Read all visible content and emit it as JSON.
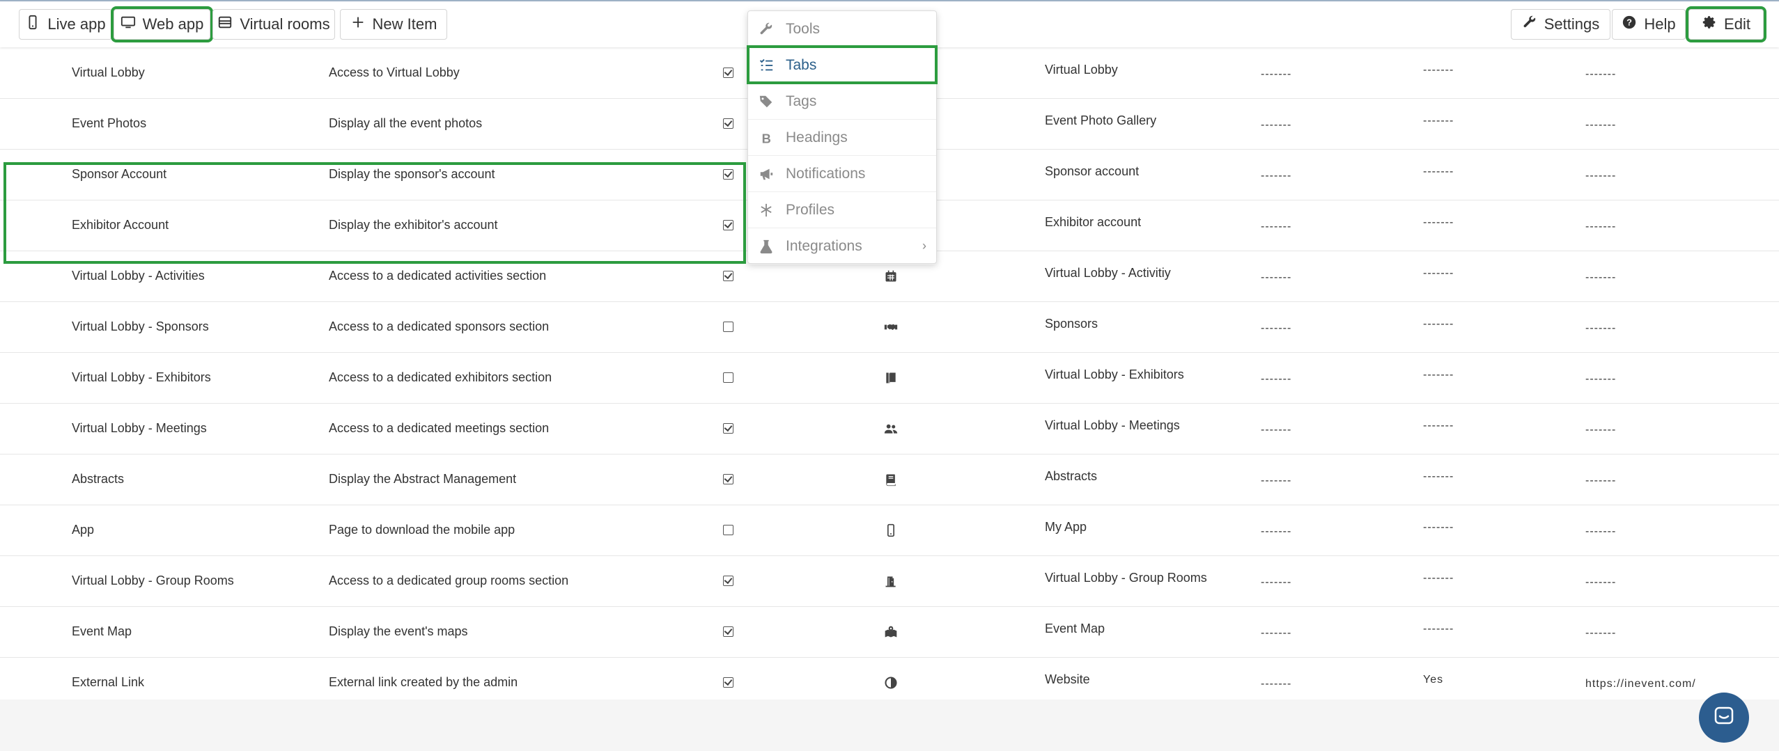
{
  "toolbar": {
    "live_app": "Live app",
    "web_app": "Web app",
    "virtual_rooms": "Virtual rooms",
    "new_item": "New Item",
    "settings": "Settings",
    "help": "Help",
    "edit": "Edit"
  },
  "menu": {
    "items": [
      {
        "label": "Tools",
        "icon": "wrench-icon"
      },
      {
        "label": "Tabs",
        "icon": "list-check-icon"
      },
      {
        "label": "Tags",
        "icon": "tags-icon"
      },
      {
        "label": "Headings",
        "icon": "bold-b-icon"
      },
      {
        "label": "Notifications",
        "icon": "megaphone-icon"
      },
      {
        "label": "Profiles",
        "icon": "asterisk-icon"
      },
      {
        "label": "Integrations",
        "icon": "flask-icon"
      }
    ],
    "integrations_chevron": "›"
  },
  "rows": [
    {
      "name": "Virtual Lobby",
      "desc": "Access to Virtual Lobby",
      "checked": true,
      "icon": "",
      "tab": "Virtual Lobby",
      "d1": "-------",
      "d2": "-------",
      "d3": "-------"
    },
    {
      "name": "Event Photos",
      "desc": "Display all the event photos",
      "checked": true,
      "icon": "",
      "tab": "Event Photo Gallery",
      "d1": "-------",
      "d2": "-------",
      "d3": "-------"
    },
    {
      "name": "Sponsor Account",
      "desc": "Display the sponsor's account",
      "checked": true,
      "icon": "",
      "tab": "Sponsor account",
      "d1": "-------",
      "d2": "-------",
      "d3": "-------"
    },
    {
      "name": "Exhibitor Account",
      "desc": "Display the exhibitor's account",
      "checked": true,
      "icon": "",
      "tab": "Exhibitor account",
      "d1": "-------",
      "d2": "-------",
      "d3": "-------"
    },
    {
      "name": "Virtual Lobby - Activities",
      "desc": "Access to a dedicated activities section",
      "checked": true,
      "icon": "calendar-icon",
      "tab": "Virtual Lobby - Activitiy",
      "d1": "-------",
      "d2": "-------",
      "d3": "-------"
    },
    {
      "name": "Virtual Lobby - Sponsors",
      "desc": "Access to a dedicated sponsors section",
      "checked": false,
      "icon": "handshake-icon",
      "tab": "Sponsors",
      "d1": "-------",
      "d2": "-------",
      "d3": "-------"
    },
    {
      "name": "Virtual Lobby - Exhibitors",
      "desc": "Access to a dedicated exhibitors section",
      "checked": false,
      "icon": "book-open-icon",
      "tab": "Virtual Lobby - Exhibitors",
      "d1": "-------",
      "d2": "-------",
      "d3": "-------"
    },
    {
      "name": "Virtual Lobby - Meetings",
      "desc": "Access to a dedicated meetings section",
      "checked": true,
      "icon": "users-icon",
      "tab": "Virtual Lobby - Meetings",
      "d1": "-------",
      "d2": "-------",
      "d3": "-------"
    },
    {
      "name": "Abstracts",
      "desc": "Display the Abstract Management",
      "checked": true,
      "icon": "book-icon",
      "tab": "Abstracts",
      "d1": "-------",
      "d2": "-------",
      "d3": "-------"
    },
    {
      "name": "App",
      "desc": "Page to download the mobile app",
      "checked": false,
      "icon": "mobile-icon",
      "tab": "My App",
      "d1": "-------",
      "d2": "-------",
      "d3": "-------"
    },
    {
      "name": "Virtual Lobby - Group Rooms",
      "desc": "Access to a dedicated group rooms section",
      "checked": true,
      "icon": "door-open-icon",
      "tab": "Virtual Lobby - Group Rooms",
      "d1": "-------",
      "d2": "-------",
      "d3": "-------"
    },
    {
      "name": "Event Map",
      "desc": "Display the event's maps",
      "checked": true,
      "icon": "map-marked-icon",
      "tab": "Event Map",
      "d1": "-------",
      "d2": "-------",
      "d3": "-------"
    },
    {
      "name": "External Link",
      "desc": "External link created by the admin",
      "checked": true,
      "icon": "adjust-icon",
      "tab": "Website",
      "d1": "-------",
      "d2": "Yes",
      "d3": "https://inevent.com/"
    }
  ],
  "colors": {
    "highlight": "#2c9c3f",
    "active_menu": "#2b5f8a",
    "chat_button": "#2c5d8f"
  }
}
